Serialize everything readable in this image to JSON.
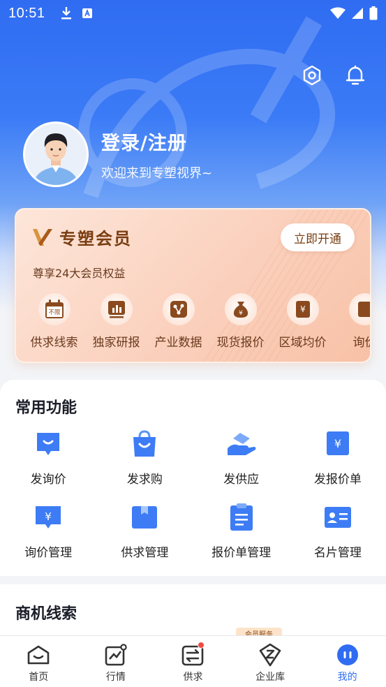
{
  "status_bar": {
    "time": "10:51"
  },
  "profile": {
    "title": "登录/注册",
    "subtitle": "欢迎来到专塑视界~"
  },
  "vip": {
    "title": "专塑会员",
    "subtitle": "尊享24大会员权益",
    "button": "立即开通",
    "badge_text": "不限",
    "items": [
      {
        "label": "供求线索",
        "icon": "calendar-unlimited-icon"
      },
      {
        "label": "独家研报",
        "icon": "bar-chart-icon"
      },
      {
        "label": "产业数据",
        "icon": "network-data-icon"
      },
      {
        "label": "现货报价",
        "icon": "money-bag-icon"
      },
      {
        "label": "区域均价",
        "icon": "yen-document-icon"
      },
      {
        "label": "询价",
        "icon": "inquiry-icon"
      }
    ]
  },
  "functions": {
    "title": "常用功能",
    "items": [
      {
        "label": "发询价",
        "icon": "chat-bubble-icon"
      },
      {
        "label": "发求购",
        "icon": "shopping-bag-icon"
      },
      {
        "label": "发供应",
        "icon": "hand-supply-icon"
      },
      {
        "label": "发报价单",
        "icon": "yen-tag-icon"
      },
      {
        "label": "询价管理",
        "icon": "yen-chat-icon"
      },
      {
        "label": "供求管理",
        "icon": "box-icon"
      },
      {
        "label": "报价单管理",
        "icon": "clipboard-icon"
      },
      {
        "label": "名片管理",
        "icon": "business-card-icon"
      }
    ]
  },
  "leads": {
    "title": "商机线索",
    "tag": "会员服务"
  },
  "tabbar": {
    "items": [
      {
        "label": "首页",
        "icon": "home-icon"
      },
      {
        "label": "行情",
        "icon": "market-chart-icon"
      },
      {
        "label": "供求",
        "icon": "exchange-icon"
      },
      {
        "label": "企业库",
        "icon": "company-icon"
      },
      {
        "label": "我的",
        "icon": "profile-icon"
      }
    ],
    "active": "我的"
  },
  "colors": {
    "primary": "#2f6cf2",
    "vip_text": "#7a3e12",
    "icon_blue": "#3d7cf4"
  }
}
